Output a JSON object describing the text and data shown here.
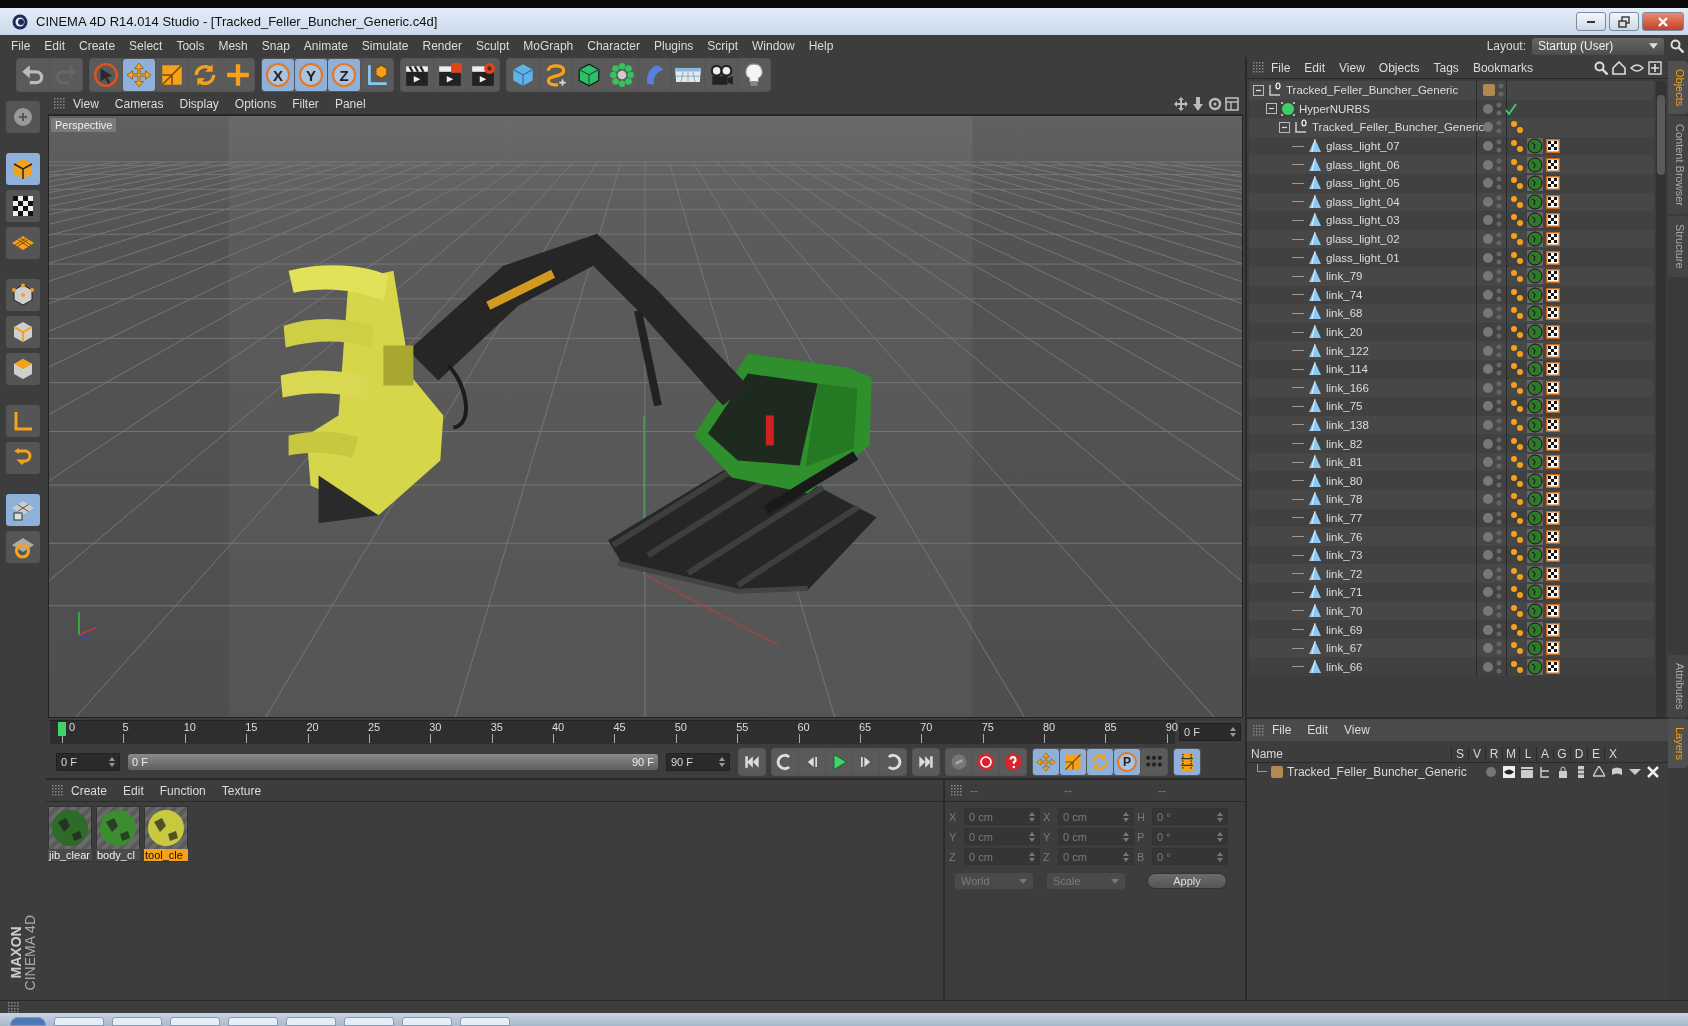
{
  "window": {
    "title": "CINEMA 4D R14.014 Studio - [Tracked_Feller_Buncher_Generic.c4d]"
  },
  "menu": [
    "File",
    "Edit",
    "Create",
    "Select",
    "Tools",
    "Mesh",
    "Snap",
    "Animate",
    "Simulate",
    "Render",
    "Sculpt",
    "MoGraph",
    "Character",
    "Plugins",
    "Script",
    "Window",
    "Help"
  ],
  "layout": {
    "label": "Layout:",
    "value": "Startup (User)"
  },
  "toolbar": [
    [
      {
        "kind": "undo",
        "selected": false
      },
      {
        "kind": "redo",
        "selected": false
      }
    ],
    [
      {
        "kind": "select",
        "selected": false
      },
      {
        "kind": "move",
        "selected": true
      },
      {
        "kind": "scale",
        "selected": false
      },
      {
        "kind": "rotate",
        "selected": false
      },
      {
        "kind": "add",
        "selected": false
      }
    ],
    [
      {
        "kind": "axis",
        "label": "X",
        "selected": true
      },
      {
        "kind": "axis",
        "label": "Y",
        "selected": true
      },
      {
        "kind": "axis",
        "label": "Z",
        "selected": true
      },
      {
        "kind": "coord",
        "selected": false
      }
    ],
    [
      {
        "kind": "render_view",
        "selected": false
      },
      {
        "kind": "render_picture",
        "selected": false
      },
      {
        "kind": "render_settings",
        "selected": false
      }
    ],
    [
      {
        "kind": "cube",
        "selected": false
      },
      {
        "kind": "spline",
        "selected": false
      },
      {
        "kind": "nurbs",
        "selected": false
      },
      {
        "kind": "array",
        "selected": false
      },
      {
        "kind": "deformer",
        "selected": false
      },
      {
        "kind": "floor",
        "selected": false
      },
      {
        "kind": "camera",
        "selected": false
      },
      {
        "kind": "light",
        "selected": false
      }
    ]
  ],
  "left_tools": [
    {
      "kind": "view",
      "selected": false
    },
    {
      "kind": "model",
      "selected": true
    },
    {
      "kind": "texture",
      "selected": false
    },
    {
      "kind": "workplane",
      "selected": false
    },
    {
      "kind": "points",
      "selected": false
    },
    {
      "kind": "edges",
      "selected": false
    },
    {
      "kind": "polygons",
      "selected": false
    },
    {
      "kind": "axis",
      "selected": false
    },
    {
      "kind": "tweak",
      "selected": false
    },
    {
      "kind": "gridlock",
      "selected": true
    },
    {
      "kind": "snap",
      "selected": false
    }
  ],
  "viewport": {
    "menu": [
      "View",
      "Cameras",
      "Display",
      "Options",
      "Filter",
      "Panel"
    ],
    "camera": "Perspective"
  },
  "timeline": {
    "ticks": [
      "0",
      "5",
      "10",
      "15",
      "20",
      "25",
      "30",
      "35",
      "40",
      "45",
      "50",
      "55",
      "60",
      "65",
      "70",
      "75",
      "80",
      "85",
      "90"
    ],
    "level": 0,
    "current_frame": "0 F",
    "start": "0 F",
    "range": {
      "start": "0 F",
      "end": "90 F",
      "level": 1
    },
    "end": "90 F"
  },
  "playback": [
    [
      {
        "kind": "first",
        "selected": false
      }
    ],
    [
      {
        "kind": "loop_back",
        "selected": false
      },
      {
        "kind": "prev",
        "selected": false
      },
      {
        "kind": "play",
        "selected": false
      },
      {
        "kind": "next",
        "selected": false
      },
      {
        "kind": "loop",
        "selected": false
      }
    ],
    [
      {
        "kind": "last",
        "selected": false
      }
    ],
    [
      {
        "kind": "chain",
        "selected": false
      },
      {
        "kind": "record",
        "selected": false
      },
      {
        "kind": "help",
        "selected": false
      }
    ],
    [
      {
        "kind": "move",
        "selected": true
      },
      {
        "kind": "scale",
        "selected": true
      },
      {
        "kind": "rotate",
        "selected": true
      },
      {
        "kind": "pla",
        "label": "P",
        "selected": true
      },
      {
        "kind": "dots",
        "selected": false
      }
    ],
    [
      {
        "kind": "film",
        "selected": true
      }
    ]
  ],
  "materials": {
    "menu": [
      "Create",
      "Edit",
      "Function",
      "Texture"
    ],
    "items": [
      {
        "name": "jib_clear",
        "color": "#2e6a28",
        "selected": false
      },
      {
        "name": "body_cl",
        "color": "#3c8c30",
        "selected": false
      },
      {
        "name": "tool_cle",
        "color": "#c9c940",
        "selected": true
      }
    ]
  },
  "coordinates": {
    "disabled": true,
    "headers": [
      "--",
      "--",
      "--"
    ],
    "rows": [
      [
        {
          "label": "X",
          "value": "0 cm"
        },
        {
          "label": "X",
          "value": "0 cm"
        },
        {
          "label": "H",
          "value": "0 °"
        }
      ],
      [
        {
          "label": "Y",
          "value": "0 cm"
        },
        {
          "label": "Y",
          "value": "0 cm"
        },
        {
          "label": "P",
          "value": "0 °"
        }
      ],
      [
        {
          "label": "Z",
          "value": "0 cm"
        },
        {
          "label": "Z",
          "value": "0 cm"
        },
        {
          "label": "B",
          "value": "0 °"
        }
      ]
    ],
    "mode": "World",
    "transform": "Scale",
    "apply": "Apply"
  },
  "objects": {
    "menu": [
      "File",
      "Edit",
      "View",
      "Objects",
      "Tags",
      "Bookmarks"
    ],
    "tree": [
      {
        "name": "Tracked_Feller_Buncher_Generic",
        "kind": "null",
        "color": "#b08a50",
        "expanded": true,
        "children": [
          {
            "name": "HyperNURBS",
            "kind": "hypernurbs",
            "enabled": true,
            "expanded": true,
            "children": [
              {
                "name": "Tracked_Feller_Buncher_Generic",
                "kind": "group",
                "expanded": true,
                "children": [
                  {
                    "name": "glass_light_07",
                    "kind": "polygon"
                  },
                  {
                    "name": "glass_light_06",
                    "kind": "polygon"
                  },
                  {
                    "name": "glass_light_05",
                    "kind": "polygon"
                  },
                  {
                    "name": "glass_light_04",
                    "kind": "polygon"
                  },
                  {
                    "name": "glass_light_03",
                    "kind": "polygon"
                  },
                  {
                    "name": "glass_light_02",
                    "kind": "polygon"
                  },
                  {
                    "name": "glass_light_01",
                    "kind": "polygon"
                  },
                  {
                    "name": "link_79",
                    "kind": "polygon"
                  },
                  {
                    "name": "link_74",
                    "kind": "polygon"
                  },
                  {
                    "name": "link_68",
                    "kind": "polygon"
                  },
                  {
                    "name": "link_20",
                    "kind": "polygon"
                  },
                  {
                    "name": "link_122",
                    "kind": "polygon"
                  },
                  {
                    "name": "link_114",
                    "kind": "polygon"
                  },
                  {
                    "name": "link_166",
                    "kind": "polygon"
                  },
                  {
                    "name": "link_75",
                    "kind": "polygon"
                  },
                  {
                    "name": "link_138",
                    "kind": "polygon"
                  },
                  {
                    "name": "link_82",
                    "kind": "polygon"
                  },
                  {
                    "name": "link_81",
                    "kind": "polygon"
                  },
                  {
                    "name": "link_80",
                    "kind": "polygon"
                  },
                  {
                    "name": "link_78",
                    "kind": "polygon"
                  },
                  {
                    "name": "link_77",
                    "kind": "polygon"
                  },
                  {
                    "name": "link_76",
                    "kind": "polygon"
                  },
                  {
                    "name": "link_73",
                    "kind": "polygon"
                  },
                  {
                    "name": "link_72",
                    "kind": "polygon"
                  },
                  {
                    "name": "link_71",
                    "kind": "polygon"
                  },
                  {
                    "name": "link_70",
                    "kind": "polygon"
                  },
                  {
                    "name": "link_69",
                    "kind": "polygon"
                  },
                  {
                    "name": "link_67",
                    "kind": "polygon"
                  },
                  {
                    "name": "link_66",
                    "kind": "polygon"
                  }
                ]
              }
            ]
          }
        ]
      }
    ]
  },
  "layers": {
    "menu": [
      "File",
      "Edit",
      "View"
    ],
    "columns": [
      "Name",
      "S",
      "V",
      "R",
      "M",
      "L",
      "A",
      "G",
      "D",
      "E",
      "X"
    ],
    "rows": [
      {
        "name": "Tracked_Feller_Buncher_Generic",
        "color": "#b08a50"
      }
    ]
  },
  "side_tabs": {
    "top": [
      {
        "label": "Objects",
        "selected": true
      },
      {
        "label": "Content Browser",
        "selected": false
      },
      {
        "label": "Structure",
        "selected": false
      }
    ],
    "bottom": [
      {
        "label": "Attributes",
        "selected": false
      },
      {
        "label": "Layers",
        "selected": true
      }
    ]
  },
  "brand": [
    "MAXON",
    "CINEMA 4D"
  ]
}
